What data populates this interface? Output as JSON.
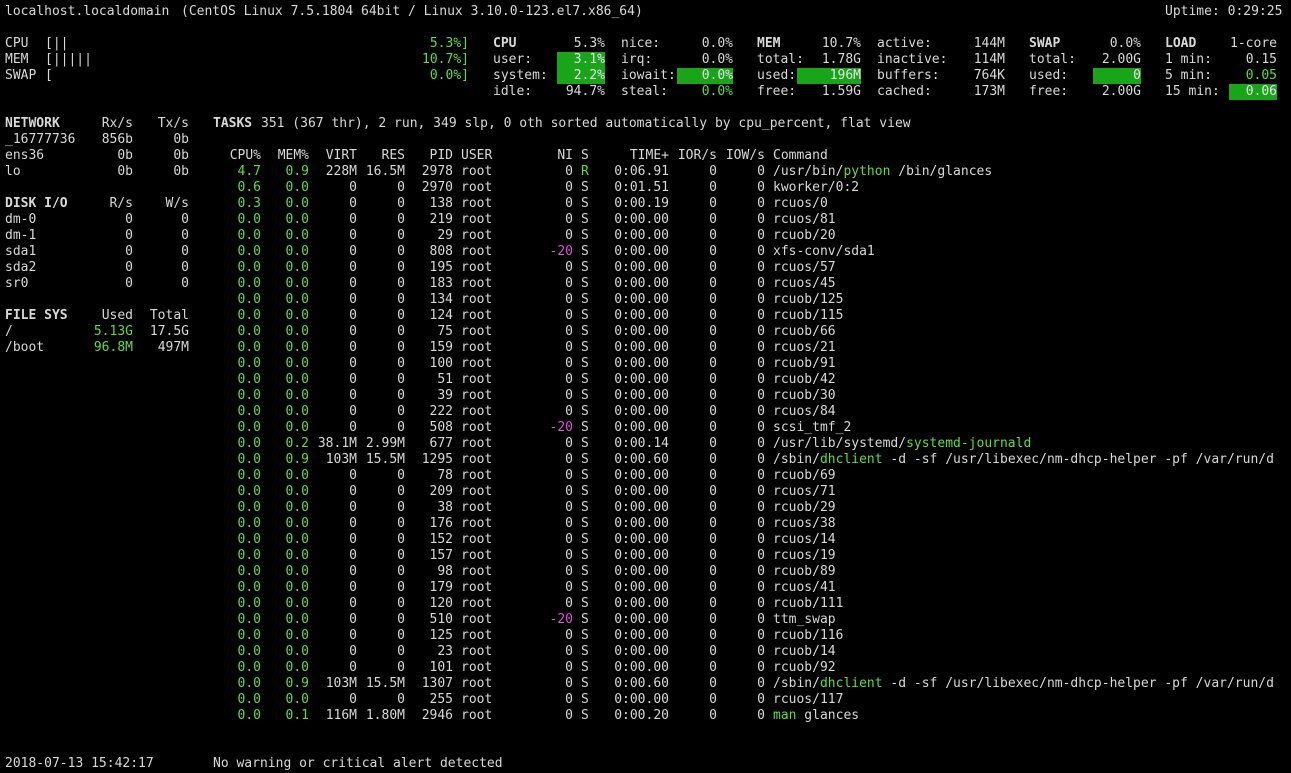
{
  "header": {
    "host": "localhost.localdomain",
    "os": "(CentOS Linux 7.5.1804 64bit / Linux 3.10.0-123.el7.x86_64)",
    "uptime": "Uptime: 0:29:25"
  },
  "quicklook": {
    "cpu_label": "CPU",
    "cpu_bar": "[||",
    "cpu_val": "5.3%]",
    "mem_label": "MEM",
    "mem_bar": "[|||||",
    "mem_val": "10.7%]",
    "swap_label": "SWAP",
    "swap_bar": "[",
    "swap_val": "0.0%]"
  },
  "cpu": {
    "title": "CPU",
    "total": "5.3%",
    "user_label": "user:",
    "user": "3.1%",
    "system_label": "system:",
    "system": "2.2%",
    "idle_label": "idle:",
    "idle": "94.7%",
    "nice_label": "nice:",
    "nice": "0.0%",
    "irq_label": "irq:",
    "irq": "0.0%",
    "iowait_label": "iowait:",
    "iowait": "0.0%",
    "steal_label": "steal:",
    "steal": "0.0%"
  },
  "mem": {
    "title": "MEM",
    "percent": "10.7%",
    "total_label": "total:",
    "total": "1.78G",
    "used_label": "used:",
    "used": "196M",
    "free_label": "free:",
    "free": "1.59G",
    "active_label": "active:",
    "active": "144M",
    "inactive_label": "inactive:",
    "inactive": "114M",
    "buffers_label": "buffers:",
    "buffers": "764K",
    "cached_label": "cached:",
    "cached": "173M"
  },
  "swap": {
    "title": "SWAP",
    "percent": "0.0%",
    "total_label": "total:",
    "total": "2.00G",
    "used_label": "used:",
    "used": "0",
    "free_label": "free:",
    "free": "2.00G"
  },
  "load": {
    "title": "LOAD",
    "cores": "1-core",
    "min1_label": "1 min:",
    "min1": "0.15",
    "min5_label": "5 min:",
    "min5": "0.05",
    "min15_label": "15 min:",
    "min15": "0.06"
  },
  "network": {
    "title": "NETWORK",
    "rx_label": "Rx/s",
    "tx_label": "Tx/s",
    "rows": [
      {
        "name": "_16777736",
        "rx": "856b",
        "tx": "0b"
      },
      {
        "name": "ens36",
        "rx": "0b",
        "tx": "0b"
      },
      {
        "name": "lo",
        "rx": "0b",
        "tx": "0b"
      }
    ]
  },
  "diskio": {
    "title": "DISK I/O",
    "r_label": "R/s",
    "w_label": "W/s",
    "rows": [
      {
        "name": "dm-0",
        "r": "0",
        "w": "0"
      },
      {
        "name": "dm-1",
        "r": "0",
        "w": "0"
      },
      {
        "name": "sda1",
        "r": "0",
        "w": "0"
      },
      {
        "name": "sda2",
        "r": "0",
        "w": "0"
      },
      {
        "name": "sr0",
        "r": "0",
        "w": "0"
      }
    ]
  },
  "filesys": {
    "title": "FILE SYS",
    "used_label": "Used",
    "total_label": "Total",
    "rows": [
      {
        "name": "/",
        "used": "5.13G",
        "total": "17.5G"
      },
      {
        "name": "/boot",
        "used": "96.8M",
        "total": "497M"
      }
    ]
  },
  "tasks": {
    "title": "TASKS",
    "summary": "351 (367 thr), 2 run, 349 slp, 0 oth sorted automatically by cpu_percent, flat view"
  },
  "proc_headers": {
    "cpu": "CPU%",
    "mem": "MEM%",
    "virt": "VIRT",
    "res": "RES",
    "pid": "PID",
    "user": "USER",
    "ni": "NI",
    "s": "S",
    "time": "TIME+",
    "ior": "IOR/s",
    "iow": "IOW/s",
    "cmd": "Command"
  },
  "processes": [
    {
      "cpu": "4.7",
      "mem": "0.9",
      "virt": "228M",
      "res": "16.5M",
      "pid": "2978",
      "user": "root",
      "ni": "0",
      "s": "R",
      "time": "0:06.91",
      "ior": "0",
      "iow": "0",
      "cmd_pre": "/usr/bin/",
      "cmd_hl": "python",
      "cmd_post": " /bin/glances"
    },
    {
      "cpu": "0.6",
      "mem": "0.0",
      "virt": "0",
      "res": "0",
      "pid": "2970",
      "user": "root",
      "ni": "0",
      "s": "S",
      "time": "0:01.51",
      "ior": "0",
      "iow": "0",
      "cmd_pre": "kworker/0:2",
      "cmd_hl": "",
      "cmd_post": ""
    },
    {
      "cpu": "0.3",
      "mem": "0.0",
      "virt": "0",
      "res": "0",
      "pid": "138",
      "user": "root",
      "ni": "0",
      "s": "S",
      "time": "0:00.19",
      "ior": "0",
      "iow": "0",
      "cmd_pre": "rcuos/0",
      "cmd_hl": "",
      "cmd_post": ""
    },
    {
      "cpu": "0.0",
      "mem": "0.0",
      "virt": "0",
      "res": "0",
      "pid": "219",
      "user": "root",
      "ni": "0",
      "s": "S",
      "time": "0:00.00",
      "ior": "0",
      "iow": "0",
      "cmd_pre": "rcuos/81",
      "cmd_hl": "",
      "cmd_post": ""
    },
    {
      "cpu": "0.0",
      "mem": "0.0",
      "virt": "0",
      "res": "0",
      "pid": "29",
      "user": "root",
      "ni": "0",
      "s": "S",
      "time": "0:00.00",
      "ior": "0",
      "iow": "0",
      "cmd_pre": "rcuob/20",
      "cmd_hl": "",
      "cmd_post": ""
    },
    {
      "cpu": "0.0",
      "mem": "0.0",
      "virt": "0",
      "res": "0",
      "pid": "808",
      "user": "root",
      "ni": "-20",
      "s": "S",
      "time": "0:00.00",
      "ior": "0",
      "iow": "0",
      "cmd_pre": "xfs-conv/sda1",
      "cmd_hl": "",
      "cmd_post": ""
    },
    {
      "cpu": "0.0",
      "mem": "0.0",
      "virt": "0",
      "res": "0",
      "pid": "195",
      "user": "root",
      "ni": "0",
      "s": "S",
      "time": "0:00.00",
      "ior": "0",
      "iow": "0",
      "cmd_pre": "rcuos/57",
      "cmd_hl": "",
      "cmd_post": ""
    },
    {
      "cpu": "0.0",
      "mem": "0.0",
      "virt": "0",
      "res": "0",
      "pid": "183",
      "user": "root",
      "ni": "0",
      "s": "S",
      "time": "0:00.00",
      "ior": "0",
      "iow": "0",
      "cmd_pre": "rcuos/45",
      "cmd_hl": "",
      "cmd_post": ""
    },
    {
      "cpu": "0.0",
      "mem": "0.0",
      "virt": "0",
      "res": "0",
      "pid": "134",
      "user": "root",
      "ni": "0",
      "s": "S",
      "time": "0:00.00",
      "ior": "0",
      "iow": "0",
      "cmd_pre": "rcuob/125",
      "cmd_hl": "",
      "cmd_post": ""
    },
    {
      "cpu": "0.0",
      "mem": "0.0",
      "virt": "0",
      "res": "0",
      "pid": "124",
      "user": "root",
      "ni": "0",
      "s": "S",
      "time": "0:00.00",
      "ior": "0",
      "iow": "0",
      "cmd_pre": "rcuob/115",
      "cmd_hl": "",
      "cmd_post": ""
    },
    {
      "cpu": "0.0",
      "mem": "0.0",
      "virt": "0",
      "res": "0",
      "pid": "75",
      "user": "root",
      "ni": "0",
      "s": "S",
      "time": "0:00.00",
      "ior": "0",
      "iow": "0",
      "cmd_pre": "rcuob/66",
      "cmd_hl": "",
      "cmd_post": ""
    },
    {
      "cpu": "0.0",
      "mem": "0.0",
      "virt": "0",
      "res": "0",
      "pid": "159",
      "user": "root",
      "ni": "0",
      "s": "S",
      "time": "0:00.00",
      "ior": "0",
      "iow": "0",
      "cmd_pre": "rcuos/21",
      "cmd_hl": "",
      "cmd_post": ""
    },
    {
      "cpu": "0.0",
      "mem": "0.0",
      "virt": "0",
      "res": "0",
      "pid": "100",
      "user": "root",
      "ni": "0",
      "s": "S",
      "time": "0:00.00",
      "ior": "0",
      "iow": "0",
      "cmd_pre": "rcuob/91",
      "cmd_hl": "",
      "cmd_post": ""
    },
    {
      "cpu": "0.0",
      "mem": "0.0",
      "virt": "0",
      "res": "0",
      "pid": "51",
      "user": "root",
      "ni": "0",
      "s": "S",
      "time": "0:00.00",
      "ior": "0",
      "iow": "0",
      "cmd_pre": "rcuob/42",
      "cmd_hl": "",
      "cmd_post": ""
    },
    {
      "cpu": "0.0",
      "mem": "0.0",
      "virt": "0",
      "res": "0",
      "pid": "39",
      "user": "root",
      "ni": "0",
      "s": "S",
      "time": "0:00.00",
      "ior": "0",
      "iow": "0",
      "cmd_pre": "rcuob/30",
      "cmd_hl": "",
      "cmd_post": ""
    },
    {
      "cpu": "0.0",
      "mem": "0.0",
      "virt": "0",
      "res": "0",
      "pid": "222",
      "user": "root",
      "ni": "0",
      "s": "S",
      "time": "0:00.00",
      "ior": "0",
      "iow": "0",
      "cmd_pre": "rcuos/84",
      "cmd_hl": "",
      "cmd_post": ""
    },
    {
      "cpu": "0.0",
      "mem": "0.0",
      "virt": "0",
      "res": "0",
      "pid": "508",
      "user": "root",
      "ni": "-20",
      "s": "S",
      "time": "0:00.00",
      "ior": "0",
      "iow": "0",
      "cmd_pre": "scsi_tmf_2",
      "cmd_hl": "",
      "cmd_post": ""
    },
    {
      "cpu": "0.0",
      "mem": "0.2",
      "virt": "38.1M",
      "res": "2.99M",
      "pid": "677",
      "user": "root",
      "ni": "0",
      "s": "S",
      "time": "0:00.14",
      "ior": "0",
      "iow": "0",
      "cmd_pre": "/usr/lib/systemd/",
      "cmd_hl": "systemd-journald",
      "cmd_post": ""
    },
    {
      "cpu": "0.0",
      "mem": "0.9",
      "virt": "103M",
      "res": "15.5M",
      "pid": "1295",
      "user": "root",
      "ni": "0",
      "s": "S",
      "time": "0:00.60",
      "ior": "0",
      "iow": "0",
      "cmd_pre": "/sbin/",
      "cmd_hl": "dhclient",
      "cmd_post": " -d -sf /usr/libexec/nm-dhcp-helper -pf /var/run/d"
    },
    {
      "cpu": "0.0",
      "mem": "0.0",
      "virt": "0",
      "res": "0",
      "pid": "78",
      "user": "root",
      "ni": "0",
      "s": "S",
      "time": "0:00.00",
      "ior": "0",
      "iow": "0",
      "cmd_pre": "rcuob/69",
      "cmd_hl": "",
      "cmd_post": ""
    },
    {
      "cpu": "0.0",
      "mem": "0.0",
      "virt": "0",
      "res": "0",
      "pid": "209",
      "user": "root",
      "ni": "0",
      "s": "S",
      "time": "0:00.00",
      "ior": "0",
      "iow": "0",
      "cmd_pre": "rcuos/71",
      "cmd_hl": "",
      "cmd_post": ""
    },
    {
      "cpu": "0.0",
      "mem": "0.0",
      "virt": "0",
      "res": "0",
      "pid": "38",
      "user": "root",
      "ni": "0",
      "s": "S",
      "time": "0:00.00",
      "ior": "0",
      "iow": "0",
      "cmd_pre": "rcuob/29",
      "cmd_hl": "",
      "cmd_post": ""
    },
    {
      "cpu": "0.0",
      "mem": "0.0",
      "virt": "0",
      "res": "0",
      "pid": "176",
      "user": "root",
      "ni": "0",
      "s": "S",
      "time": "0:00.00",
      "ior": "0",
      "iow": "0",
      "cmd_pre": "rcuos/38",
      "cmd_hl": "",
      "cmd_post": ""
    },
    {
      "cpu": "0.0",
      "mem": "0.0",
      "virt": "0",
      "res": "0",
      "pid": "152",
      "user": "root",
      "ni": "0",
      "s": "S",
      "time": "0:00.00",
      "ior": "0",
      "iow": "0",
      "cmd_pre": "rcuos/14",
      "cmd_hl": "",
      "cmd_post": ""
    },
    {
      "cpu": "0.0",
      "mem": "0.0",
      "virt": "0",
      "res": "0",
      "pid": "157",
      "user": "root",
      "ni": "0",
      "s": "S",
      "time": "0:00.00",
      "ior": "0",
      "iow": "0",
      "cmd_pre": "rcuos/19",
      "cmd_hl": "",
      "cmd_post": ""
    },
    {
      "cpu": "0.0",
      "mem": "0.0",
      "virt": "0",
      "res": "0",
      "pid": "98",
      "user": "root",
      "ni": "0",
      "s": "S",
      "time": "0:00.00",
      "ior": "0",
      "iow": "0",
      "cmd_pre": "rcuob/89",
      "cmd_hl": "",
      "cmd_post": ""
    },
    {
      "cpu": "0.0",
      "mem": "0.0",
      "virt": "0",
      "res": "0",
      "pid": "179",
      "user": "root",
      "ni": "0",
      "s": "S",
      "time": "0:00.00",
      "ior": "0",
      "iow": "0",
      "cmd_pre": "rcuos/41",
      "cmd_hl": "",
      "cmd_post": ""
    },
    {
      "cpu": "0.0",
      "mem": "0.0",
      "virt": "0",
      "res": "0",
      "pid": "120",
      "user": "root",
      "ni": "0",
      "s": "S",
      "time": "0:00.00",
      "ior": "0",
      "iow": "0",
      "cmd_pre": "rcuob/111",
      "cmd_hl": "",
      "cmd_post": ""
    },
    {
      "cpu": "0.0",
      "mem": "0.0",
      "virt": "0",
      "res": "0",
      "pid": "510",
      "user": "root",
      "ni": "-20",
      "s": "S",
      "time": "0:00.00",
      "ior": "0",
      "iow": "0",
      "cmd_pre": "ttm_swap",
      "cmd_hl": "",
      "cmd_post": ""
    },
    {
      "cpu": "0.0",
      "mem": "0.0",
      "virt": "0",
      "res": "0",
      "pid": "125",
      "user": "root",
      "ni": "0",
      "s": "S",
      "time": "0:00.00",
      "ior": "0",
      "iow": "0",
      "cmd_pre": "rcuob/116",
      "cmd_hl": "",
      "cmd_post": ""
    },
    {
      "cpu": "0.0",
      "mem": "0.0",
      "virt": "0",
      "res": "0",
      "pid": "23",
      "user": "root",
      "ni": "0",
      "s": "S",
      "time": "0:00.00",
      "ior": "0",
      "iow": "0",
      "cmd_pre": "rcuob/14",
      "cmd_hl": "",
      "cmd_post": ""
    },
    {
      "cpu": "0.0",
      "mem": "0.0",
      "virt": "0",
      "res": "0",
      "pid": "101",
      "user": "root",
      "ni": "0",
      "s": "S",
      "time": "0:00.00",
      "ior": "0",
      "iow": "0",
      "cmd_pre": "rcuob/92",
      "cmd_hl": "",
      "cmd_post": ""
    },
    {
      "cpu": "0.0",
      "mem": "0.9",
      "virt": "103M",
      "res": "15.5M",
      "pid": "1307",
      "user": "root",
      "ni": "0",
      "s": "S",
      "time": "0:00.60",
      "ior": "0",
      "iow": "0",
      "cmd_pre": "/sbin/",
      "cmd_hl": "dhclient",
      "cmd_post": " -d -sf /usr/libexec/nm-dhcp-helper -pf /var/run/d"
    },
    {
      "cpu": "0.0",
      "mem": "0.0",
      "virt": "0",
      "res": "0",
      "pid": "255",
      "user": "root",
      "ni": "0",
      "s": "S",
      "time": "0:00.00",
      "ior": "0",
      "iow": "0",
      "cmd_pre": "rcuos/117",
      "cmd_hl": "",
      "cmd_post": ""
    },
    {
      "cpu": "0.0",
      "mem": "0.1",
      "virt": "116M",
      "res": "1.80M",
      "pid": "2946",
      "user": "root",
      "ni": "0",
      "s": "S",
      "time": "0:00.20",
      "ior": "0",
      "iow": "0",
      "cmd_pre": "",
      "cmd_hl": "man",
      "cmd_post": " glances"
    }
  ],
  "footer": {
    "datetime": "2018-07-13 15:42:17",
    "alert": "No warning or critical alert detected"
  },
  "colors": {
    "background": "#000000",
    "text": "#d8d8d8",
    "ok_green": "#5fdf3a",
    "highlight_green": "#19a519",
    "nice_magenta": "#df4fdf"
  }
}
